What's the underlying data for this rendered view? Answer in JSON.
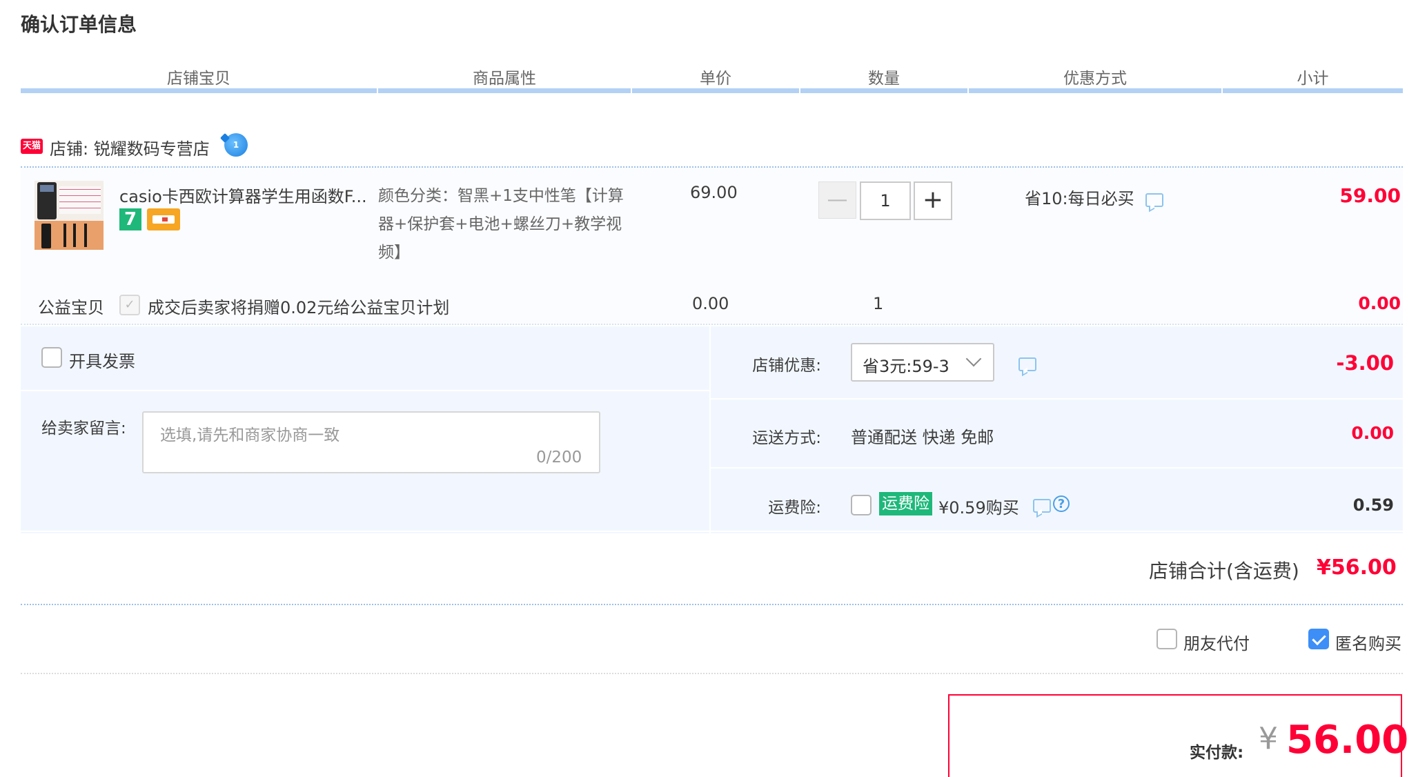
{
  "page": {
    "title": "确认订单信息"
  },
  "columns": [
    "店铺宝贝",
    "商品属性",
    "单价",
    "数量",
    "优惠方式",
    "小计"
  ],
  "shop": {
    "badge": "天猫",
    "label": "店铺: 锐耀数码专营店"
  },
  "item": {
    "title": "casio卡西欧计算器学生用函数F...",
    "attribute": "颜色分类：智黑+1支中性笔【计算器+保护套+电池+螺丝刀+教学视频】",
    "unit_price": "69.00",
    "quantity": "1",
    "minus": "—",
    "plus": "+",
    "promo": "省10:每日必买",
    "subtotal": "59.00",
    "icon_7": "7"
  },
  "charity": {
    "label": "公益宝贝",
    "description": "成交后卖家将捐赠0.02元给公益宝贝计划",
    "price": "0.00",
    "quantity": "1",
    "subtotal": "0.00",
    "checked": true
  },
  "options": {
    "invoice_label": "开具发票",
    "message_label": "给卖家留言:",
    "message_placeholder": "选填,请先和商家协商一致",
    "message_count": "0/200",
    "shop_discount_label": "店铺优惠:",
    "shop_discount_value": "省3元:59-3",
    "shop_discount_amount": "-3.00",
    "shipping_label": "运送方式:",
    "shipping_value": "普通配送 快递 免邮",
    "shipping_amount": "0.00",
    "insurance_label": "运费险:",
    "insurance_tag": "运费险",
    "insurance_text": "¥0.59购买",
    "insurance_amount": "0.59"
  },
  "shop_total": {
    "label": "店铺合计(含运费)",
    "amount": "¥56.00"
  },
  "extras": {
    "friend_pay": "朋友代付",
    "anonymous": "匿名购买",
    "friend_pay_checked": false,
    "anonymous_checked": true
  },
  "payment": {
    "label": "实付款:",
    "currency": "¥",
    "amount": "56.00"
  },
  "colors": {
    "accent_red": "#ff0036",
    "header_line": "#b2d1f5",
    "option_bg": "#f2f7ff",
    "checkbox_blue": "#3d8ef7",
    "tag_green": "#1eb87a"
  }
}
